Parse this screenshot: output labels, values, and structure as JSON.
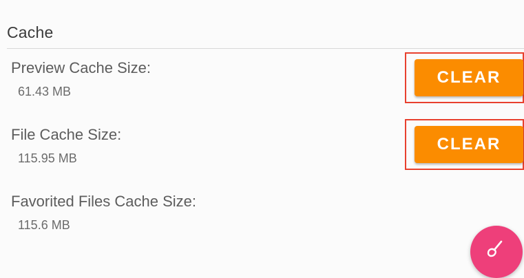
{
  "cache": {
    "section_title": "Cache",
    "items": [
      {
        "label": "Preview Cache Size:",
        "value": "61.43 MB",
        "button_label": "CLEAR"
      },
      {
        "label": "File Cache Size:",
        "value": "115.95 MB",
        "button_label": "CLEAR"
      },
      {
        "label": "Favorited Files Cache Size:",
        "value": "115.6 MB"
      }
    ]
  },
  "colors": {
    "accent_button": "#fb8c00",
    "highlight_border": "#e8402e",
    "fab": "#ee3f7a"
  },
  "icons": {
    "fab_icon": "brush-icon"
  }
}
